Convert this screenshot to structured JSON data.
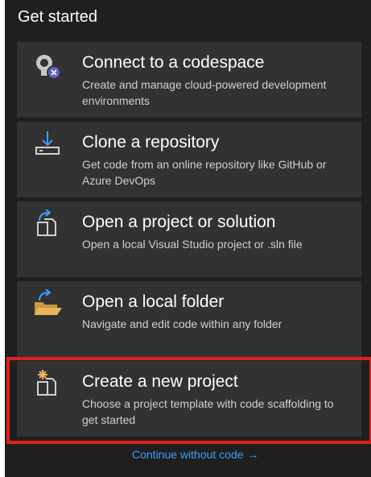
{
  "header": {
    "title": "Get started"
  },
  "cards": [
    {
      "title": "Connect to a codespace",
      "description": "Create and manage cloud-powered development environments",
      "icon": "codespace-icon"
    },
    {
      "title": "Clone a repository",
      "description": "Get code from an online repository like GitHub or Azure DevOps",
      "icon": "clone-download-icon"
    },
    {
      "title": "Open a project or solution",
      "description": "Open a local Visual Studio project or .sln file",
      "icon": "open-project-icon"
    },
    {
      "title": "Open a local folder",
      "description": "Navigate and edit code within any folder",
      "icon": "open-folder-icon"
    },
    {
      "title": "Create a new project",
      "description": "Choose a project template with code scaffolding to get started",
      "icon": "new-project-icon"
    }
  ],
  "footer": {
    "continue_label": "Continue without code",
    "arrow": "→"
  },
  "colors": {
    "background": "#1f1f1f",
    "card": "#323233",
    "link": "#3e9dfa",
    "highlight": "#e0201c"
  }
}
